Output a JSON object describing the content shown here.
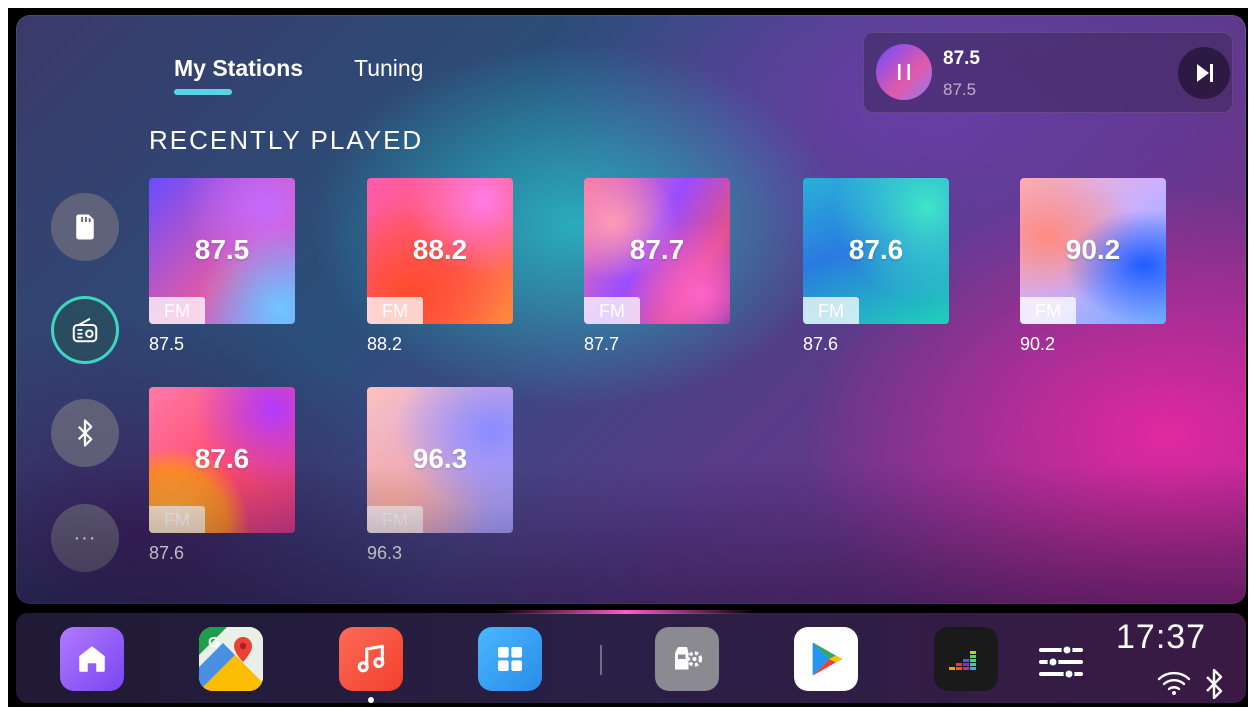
{
  "tabs": [
    {
      "label": "My Stations",
      "active": true
    },
    {
      "label": "Tuning",
      "active": false
    }
  ],
  "section_title": "RECENTLY PLAYED",
  "sidebar": {
    "items": [
      {
        "icon": "sd-card-icon"
      },
      {
        "icon": "radio-icon",
        "active": true
      },
      {
        "icon": "bluetooth-icon"
      },
      {
        "icon": "more-icon",
        "label": "···"
      }
    ]
  },
  "stations": [
    {
      "frequency": "87.5",
      "band": "FM",
      "caption": "87.5"
    },
    {
      "frequency": "88.2",
      "band": "FM",
      "caption": "88.2"
    },
    {
      "frequency": "87.7",
      "band": "FM",
      "caption": "87.7"
    },
    {
      "frequency": "87.6",
      "band": "FM",
      "caption": "87.6"
    },
    {
      "frequency": "90.2",
      "band": "FM",
      "caption": "90.2"
    },
    {
      "frequency": "87.6",
      "band": "FM",
      "caption": "87.6"
    },
    {
      "frequency": "96.3",
      "band": "FM",
      "caption": "96.3"
    }
  ],
  "now_playing": {
    "title": "87.5",
    "subtitle": "87.5",
    "state": "playing"
  },
  "dock": {
    "apps": [
      {
        "name": "home-app",
        "icon": "home-icon"
      },
      {
        "name": "maps-app",
        "icon": "google-maps-icon"
      },
      {
        "name": "music-app",
        "icon": "music-note-icon",
        "active": true
      },
      {
        "name": "apps-app",
        "icon": "app-grid-icon"
      },
      {
        "name": "car-settings-app",
        "icon": "car-settings-icon"
      },
      {
        "name": "play-store-app",
        "icon": "google-play-icon"
      },
      {
        "name": "deezer-app",
        "icon": "deezer-icon"
      },
      {
        "name": "equalizer-app",
        "icon": "equalizer-icon"
      }
    ],
    "time": "17:37",
    "status_icons": [
      "wifi-icon",
      "bluetooth-icon"
    ]
  },
  "colors": {
    "accent": "#5ad3e8",
    "radio_active_ring": "#3ed6c0"
  }
}
